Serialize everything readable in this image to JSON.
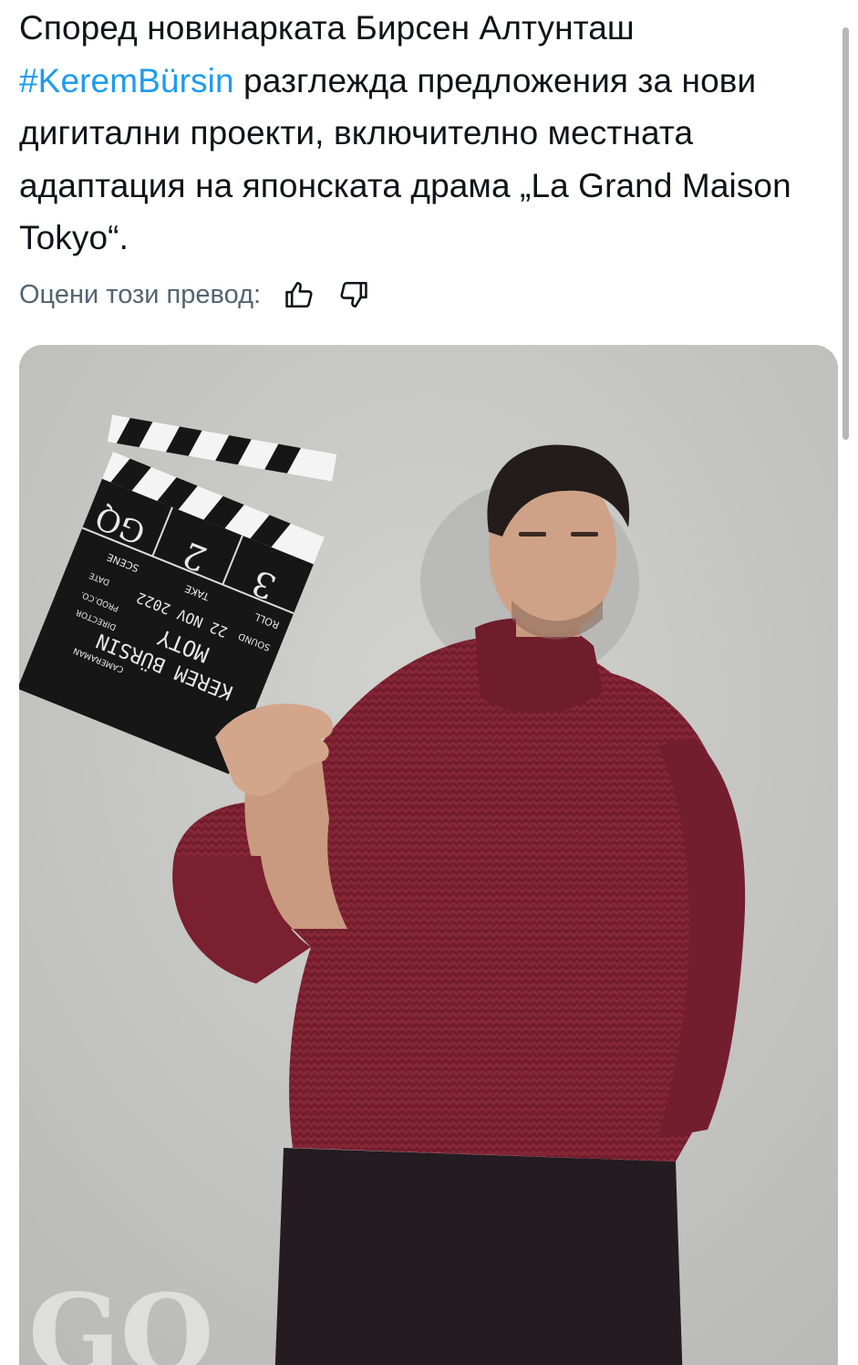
{
  "tweet": {
    "text_before": "Според новинарката Бирсен Алтунташ ",
    "hashtag": "#KeremBürsin",
    "text_after": " разглежда предложения за нови дигитални проекти, включително местната адаптация на японската драма „La Grand Maison Tokyo“."
  },
  "translation_rating": {
    "label": "Оцени този превод:",
    "like_icon": "thumbs-up-icon",
    "dislike_icon": "thumbs-down-icon"
  },
  "media": {
    "clapper": {
      "name": "KEREM BÜRSIN",
      "production": "GQ",
      "director": "MOTY",
      "date": "22 NOV 2022",
      "scene": "SCENE",
      "take_label": "TAKE",
      "take": "2",
      "roll_label": "ROLL",
      "roll": "3",
      "sound": "SOUND",
      "prod_co": "PROD.CO.",
      "director_label": "DIRECTOR",
      "camera_label": "CAMERAMAN",
      "date_label": "DATE"
    },
    "watermark": "GQ"
  },
  "colors": {
    "text": "#0f1419",
    "hashtag": "#1d9bf0",
    "muted": "#536471",
    "sweater": "#7e2232",
    "background": "#c8c8c6"
  }
}
